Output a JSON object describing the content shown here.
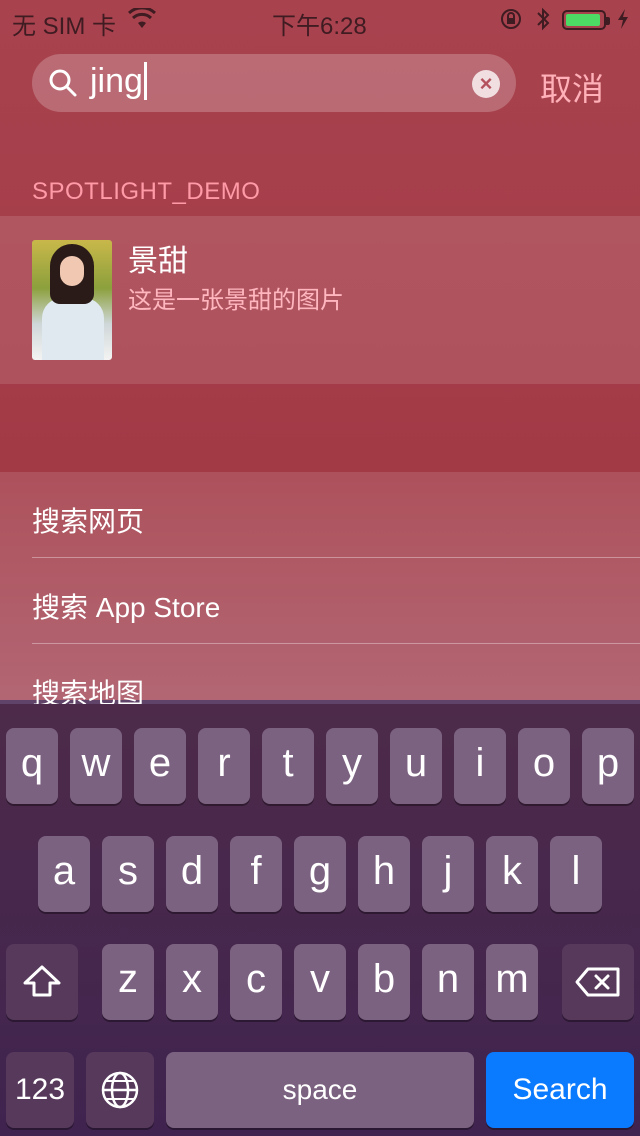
{
  "status_bar": {
    "carrier": "无 SIM 卡",
    "time": "下午6:28"
  },
  "search": {
    "query": "jing",
    "cancel_label": "取消"
  },
  "results": {
    "section_title": "SPOTLIGHT_DEMO",
    "item": {
      "title": "景甜",
      "subtitle": "这是一张景甜的图片"
    }
  },
  "actions": [
    {
      "label": "搜索网页"
    },
    {
      "label": "搜索 App Store"
    },
    {
      "label": "搜索地图"
    }
  ],
  "keyboard": {
    "row1": [
      "q",
      "w",
      "e",
      "r",
      "t",
      "y",
      "u",
      "i",
      "o",
      "p"
    ],
    "row2": [
      "a",
      "s",
      "d",
      "f",
      "g",
      "h",
      "j",
      "k",
      "l"
    ],
    "row3": [
      "z",
      "x",
      "c",
      "v",
      "b",
      "n",
      "m"
    ],
    "numbers_label": "123",
    "space_label": "space",
    "search_label": "Search"
  },
  "colors": {
    "accent": "#0a7aff",
    "battery": "#4cd964",
    "cancel": "#ffb0b8"
  }
}
